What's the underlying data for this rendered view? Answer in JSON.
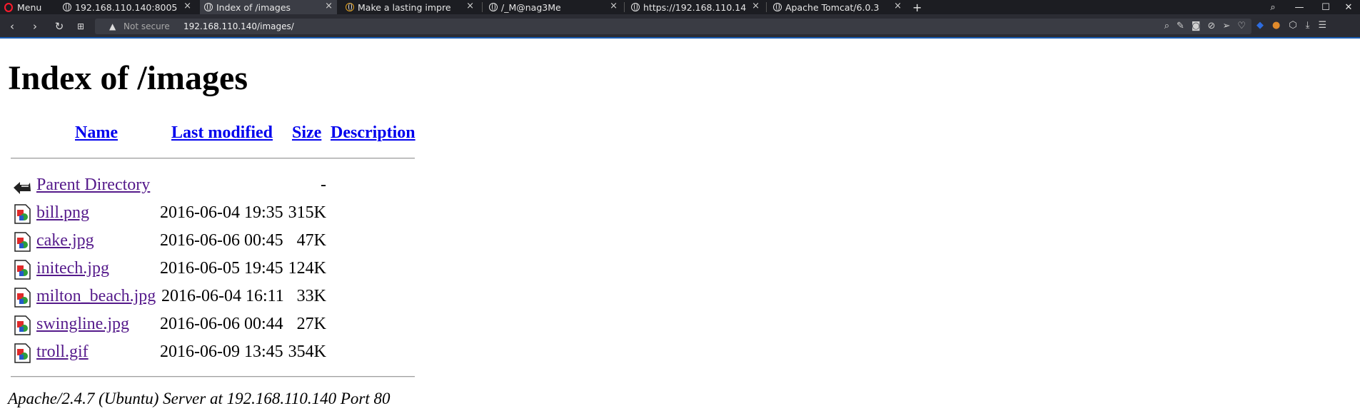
{
  "browser": {
    "menu_label": "Menu",
    "tabs": [
      {
        "title": "192.168.110.140:8005"
      },
      {
        "title": "Index of /images"
      },
      {
        "title": "Make a lasting impre"
      },
      {
        "title": "/_M@nag3Me"
      },
      {
        "title": "https://192.168.110.14"
      },
      {
        "title": "Apache Tomcat/6.0.3"
      }
    ],
    "new_tab": "+",
    "close_glyph": "×",
    "not_secure": "Not secure",
    "url": "192.168.110.140/images/",
    "accent_color": "#1a5db3"
  },
  "page": {
    "title": "Index of /images",
    "headers": {
      "name": "Name",
      "modified": "Last modified",
      "size": "Size",
      "description": "Description"
    },
    "parent": {
      "name": "Parent Directory",
      "size": "-"
    },
    "files": [
      {
        "name": "bill.png",
        "modified": "2016-06-04 19:35",
        "size": "315K"
      },
      {
        "name": "cake.jpg",
        "modified": "2016-06-06 00:45",
        "size": "47K"
      },
      {
        "name": "initech.jpg",
        "modified": "2016-06-05 19:45",
        "size": "124K"
      },
      {
        "name": "milton_beach.jpg",
        "modified": "2016-06-04 16:11",
        "size": "33K"
      },
      {
        "name": "swingline.jpg",
        "modified": "2016-06-06 00:44",
        "size": "27K"
      },
      {
        "name": "troll.gif",
        "modified": "2016-06-09 13:45",
        "size": "354K"
      }
    ],
    "address": "Apache/2.4.7 (Ubuntu) Server at 192.168.110.140 Port 80"
  }
}
